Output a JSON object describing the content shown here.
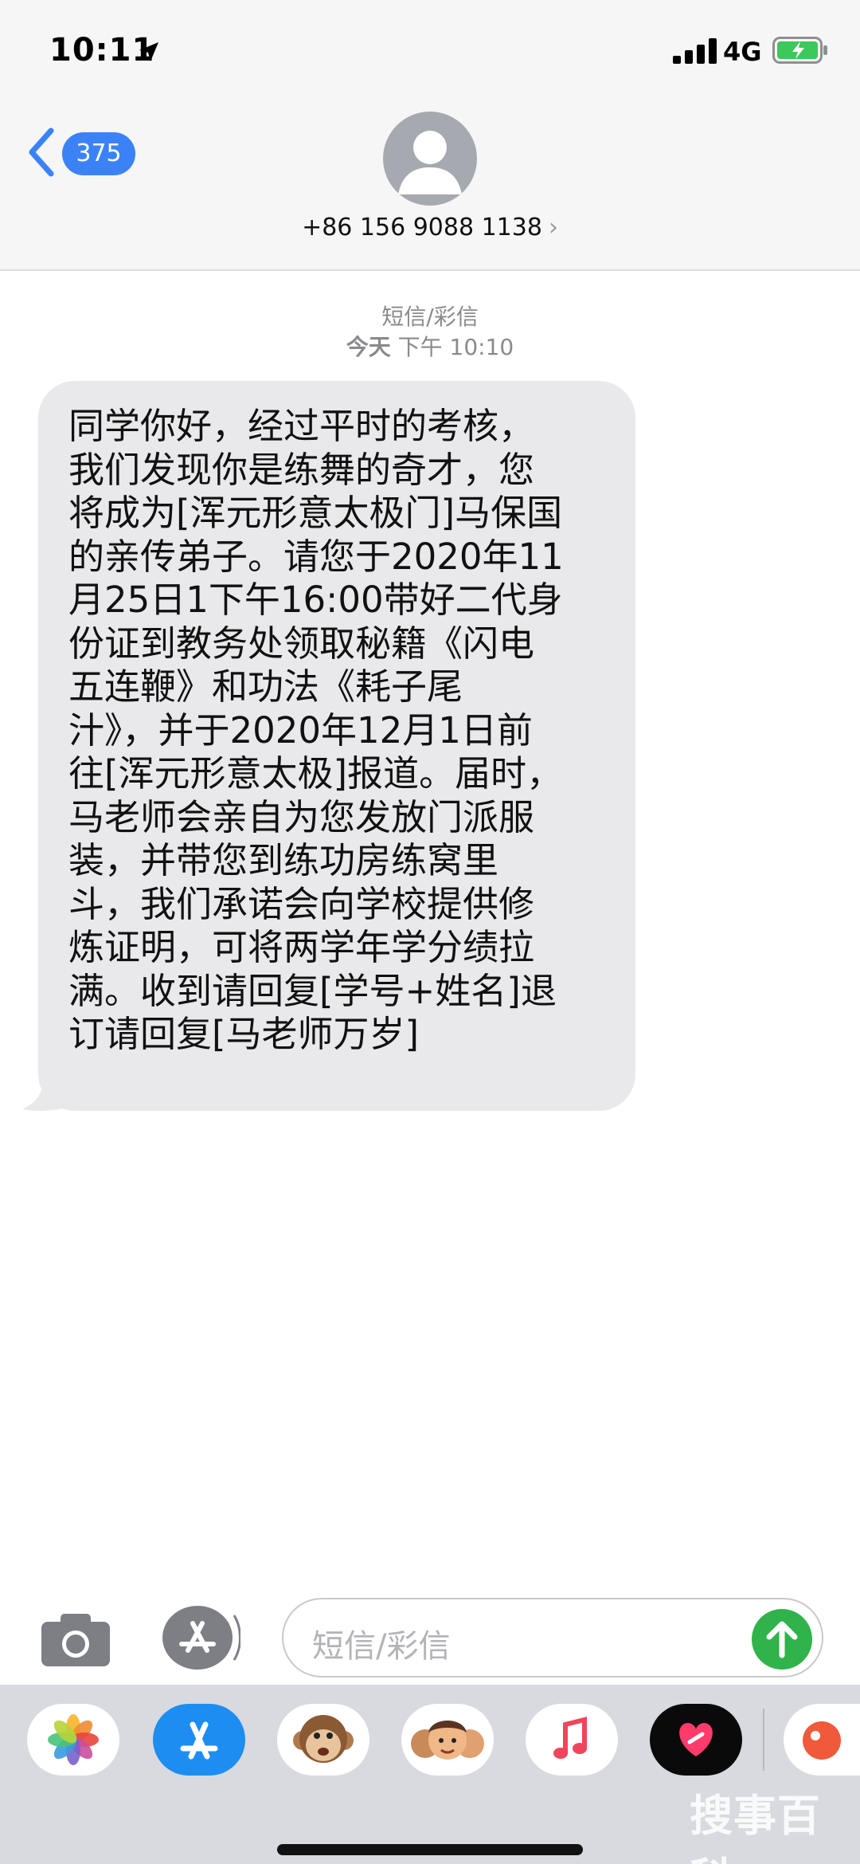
{
  "status_bar": {
    "time": "10:11",
    "network": "4G"
  },
  "nav": {
    "back_count": "375",
    "contact_number": "+86 156 9088 1138",
    "contact_chevron": "›"
  },
  "thread": {
    "message_type": "短信/彩信",
    "timestamp_day": "今天",
    "timestamp_time": "下午 10:10",
    "message_body": "同学你好，经过平时的考核，\n我们发现你是练舞的奇才，您\n将成为[浑元形意太极门]马保国\n的亲传弟子。请您于2020年11\n月25日1下午16:00带好二代身\n份证到教务处领取秘籍《闪电\n五连鞭》和功法《耗子尾\n汁》，并于2020年12月1日前\n往[浑元形意太极]报道。届时，\n马老师会亲自为您发放门派服\n装，并带您到练功房练窝里\n斗，我们承诺会向学校提供修\n炼证明，可将两学年学分绩拉\n满。收到请回复[学号+姓名]退\n订请回复[马老师万岁]"
  },
  "composer": {
    "placeholder": "短信/彩信"
  },
  "app_drawer": {
    "apps": [
      {
        "icon": "photos-icon"
      },
      {
        "icon": "app-store-icon"
      },
      {
        "icon": "animoji-monkey-icon"
      },
      {
        "icon": "memoji-icon"
      },
      {
        "icon": "music-icon"
      },
      {
        "icon": "digital-touch-icon"
      },
      {
        "icon": "partial-app-icon"
      }
    ],
    "watermark": "搜事百科"
  },
  "colors": {
    "accent": "#3b82f6",
    "send": "#2fb34a",
    "bubble": "#e9e9eb"
  }
}
